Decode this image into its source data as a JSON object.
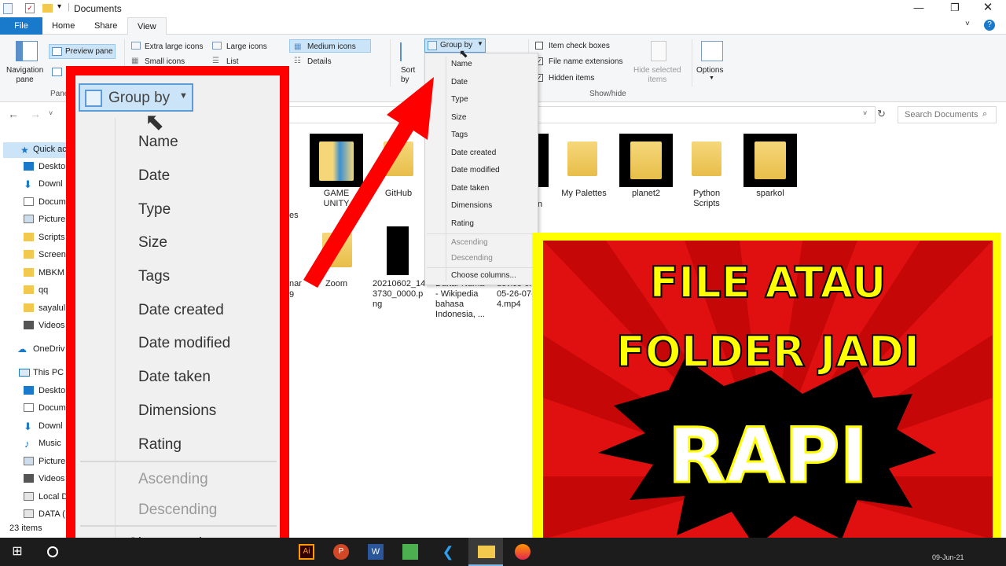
{
  "window": {
    "title": "Documents"
  },
  "ribbon": {
    "tabs": [
      "File",
      "Home",
      "Share",
      "View"
    ],
    "nav_pane": "Navigation\npane",
    "preview_pane": "Preview pane",
    "panes_label": "Pane",
    "layout": {
      "extra_large": "Extra large icons",
      "large": "Large icons",
      "medium": "Medium icons",
      "small": "Small icons",
      "list": "List",
      "details": "Details"
    },
    "sort_by": "Sort\nby",
    "group_by": "Group by",
    "item_check_boxes": "Item check boxes",
    "file_name_extensions": "File name extensions",
    "hidden_items": "Hidden items",
    "hide_selected": "Hide selected\nitems",
    "options": "Options",
    "show_hide_label": "Show/hide"
  },
  "search": {
    "placeholder": "Search Documents"
  },
  "sidebar": {
    "items": [
      "Quick ac",
      "Deskto",
      "Downl",
      "Docum",
      "Picture",
      "Scripts",
      "Screen",
      "MBKM",
      "qq",
      "sayalul",
      "Videos",
      "OneDriv",
      "This PC",
      "Deskto",
      "Docum",
      "Downl",
      "Music",
      "Picture",
      "Videos",
      "Local D",
      "DATA ("
    ]
  },
  "status": {
    "items_count": "23 items"
  },
  "files_row1": [
    {
      "name": "GAME\nUNITY"
    },
    {
      "name": "GitHub"
    },
    {
      "name": "n"
    },
    {
      "name": "My Palettes"
    },
    {
      "name": "planet2"
    },
    {
      "name": "Python\nScripts"
    },
    {
      "name": "sparkol"
    }
  ],
  "files_row2": [
    {
      "name": "Zoom"
    },
    {
      "name": "20210602_14\n3730_0000.p\nng"
    },
    {
      "name": "Daftar Nama\n- Wikipedia\nbahasa\nIndonesia, ..."
    },
    {
      "name": "device-c...\n05-26-07-...\n4.mp4"
    }
  ],
  "partial_labels": {
    "es": "es",
    "nar": "nar",
    "nine": "9"
  },
  "group_menu": {
    "items": [
      "Name",
      "Date",
      "Type",
      "Size",
      "Tags",
      "Date created",
      "Date modified",
      "Date taken",
      "Dimensions",
      "Rating"
    ],
    "ascending": "Ascending",
    "descending": "Descending",
    "choose_columns": "Choose columns..."
  },
  "banner": {
    "line1": "FILE ATAU",
    "line2": "FOLDER JADI",
    "line3": "RAPI"
  },
  "taskbar": {
    "clock": "09-Jun-21"
  },
  "colors": {
    "file_tab": "#1979ca",
    "frame_red": "#ff0000",
    "banner_yellow": "#ffff00",
    "banner_red": "#e01010"
  }
}
